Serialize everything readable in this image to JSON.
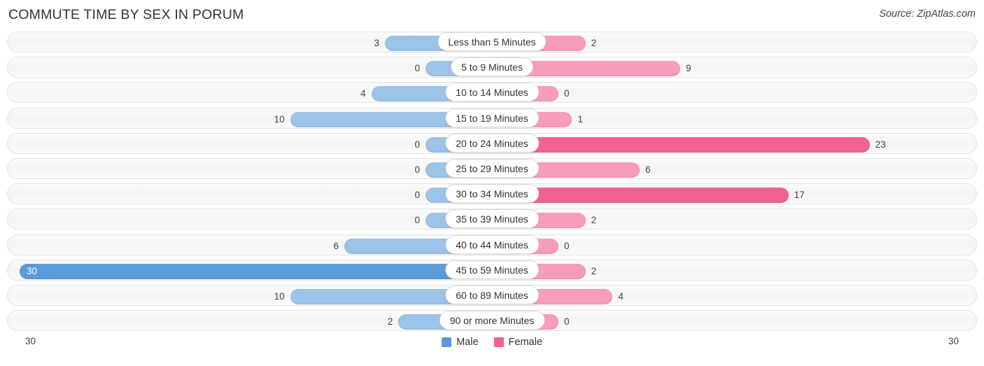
{
  "header": {
    "title": "COMMUTE TIME BY SEX IN PORUM",
    "source": "Source: ZipAtlas.com"
  },
  "legend": {
    "items": [
      {
        "label": "Male",
        "color": "#5b9bd9"
      },
      {
        "label": "Female",
        "color": "#f2628f"
      }
    ]
  },
  "axis": {
    "left_label": "30",
    "right_label": "30"
  },
  "chart_data": {
    "type": "bar",
    "subtype": "diverging-bidirectional",
    "title": "COMMUTE TIME BY SEX IN PORUM",
    "xlabel": "",
    "ylabel": "",
    "xlim": [
      30,
      30
    ],
    "axis_max": 30,
    "grid": false,
    "legend_position": "bottom-center",
    "categories": [
      "Less than 5 Minutes",
      "5 to 9 Minutes",
      "10 to 14 Minutes",
      "15 to 19 Minutes",
      "20 to 24 Minutes",
      "25 to 29 Minutes",
      "30 to 34 Minutes",
      "35 to 39 Minutes",
      "40 to 44 Minutes",
      "45 to 59 Minutes",
      "60 to 89 Minutes",
      "90 or more Minutes"
    ],
    "series": [
      {
        "name": "Male",
        "color": "#5b9bd9",
        "direction": "left",
        "values": [
          3,
          0,
          4,
          10,
          0,
          0,
          0,
          0,
          6,
          30,
          10,
          2
        ]
      },
      {
        "name": "Female",
        "color": "#f2628f",
        "direction": "right",
        "values": [
          2,
          9,
          0,
          1,
          23,
          6,
          17,
          2,
          0,
          2,
          4,
          0
        ]
      }
    ]
  }
}
